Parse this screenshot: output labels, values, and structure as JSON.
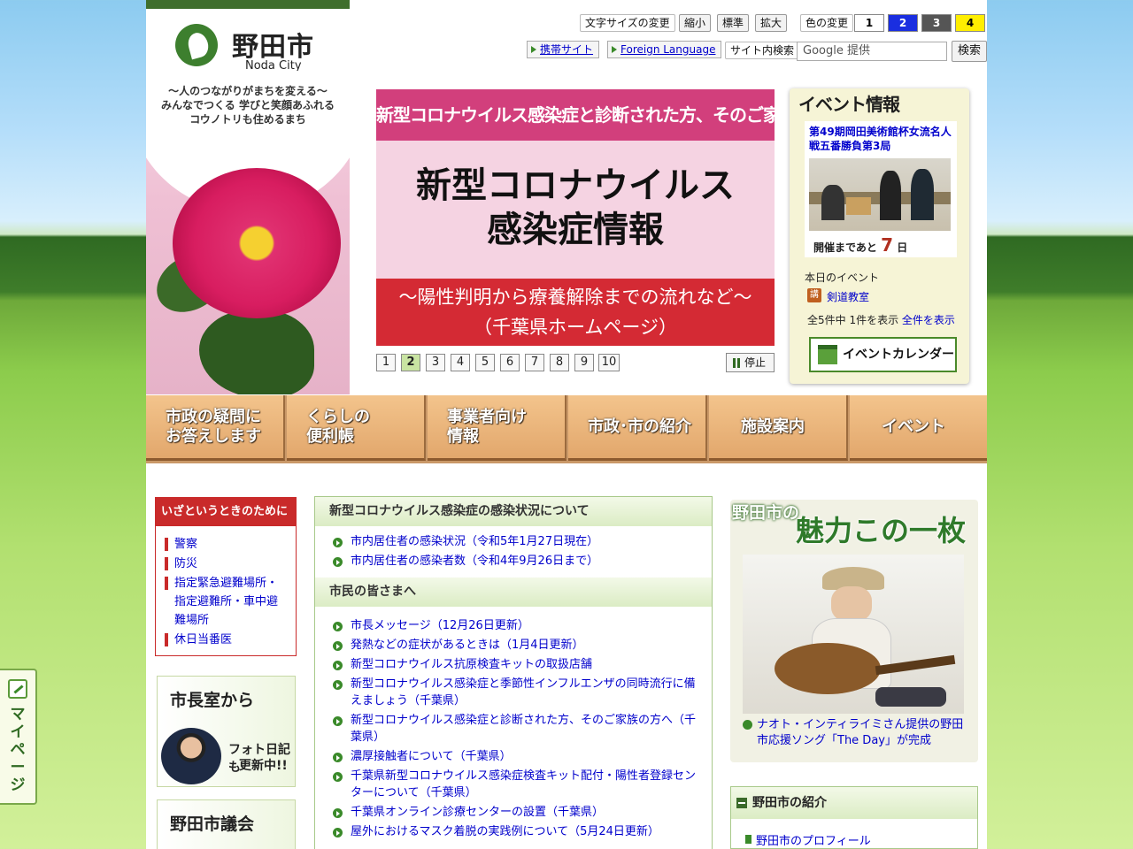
{
  "header": {
    "logo_ja": "野田市",
    "logo_en": "Noda City",
    "tagline": [
      "～人のつながりがまちを変える～",
      "みんなでつくる 学びと笑顔あふれる",
      "コウノトリも住めるまち"
    ],
    "font_size_label": "文字サイズの変更",
    "font_small": "縮小",
    "font_normal": "標準",
    "font_large": "拡大",
    "color_label": "色の変更",
    "colors": [
      "1",
      "2",
      "3",
      "4"
    ],
    "mobile_link": "携帯サイト",
    "foreign_link": "Foreign Language",
    "search_label": "サイト内検索",
    "search_placeholder": "Google 提供",
    "search_button": "検索"
  },
  "banner": {
    "top": "新型コロナウイルス感染症と診断された方、そのご家族の方へ",
    "title_line1": "新型コロナウイルス",
    "title_line2": "感染症情報",
    "sub_line1": "～陽性判明から療養解除までの流れなど～",
    "sub_line2": "（千葉県ホームページ）",
    "pages": [
      "1",
      "2",
      "3",
      "4",
      "5",
      "6",
      "7",
      "8",
      "9",
      "10"
    ],
    "active_page": 2,
    "stop_label": "停止"
  },
  "event": {
    "heading": "イベント情報",
    "featured_title": "第49期岡田美術館杯女流名人戦五番勝負第3局",
    "countdown_prefix": "開催まであと",
    "countdown_days": "7",
    "countdown_suffix": "日",
    "today_label": "本日のイベント",
    "today_icon": "講",
    "today_item": "剣道教室",
    "count_text": "全5件中 1件を表示",
    "show_all": "全件を表示",
    "calendar_button": "イベントカレンダー"
  },
  "nav": [
    [
      "市政の疑問に",
      "お答えします"
    ],
    [
      "くらしの",
      "便利帳"
    ],
    [
      "事業者向け",
      "情報"
    ],
    [
      "市政･市の紹介"
    ],
    [
      "施設案内"
    ],
    [
      "イベント"
    ]
  ],
  "emergency": {
    "heading": "いざというときのために",
    "items": [
      "警察",
      "防災",
      "指定緊急避難場所・指定避難所・車中避難場所",
      "休日当番医"
    ]
  },
  "mayor": {
    "title": "市長室から",
    "sub1": "フォト日記も",
    "sub2": "更新中!!"
  },
  "council": {
    "title": "野田市議会"
  },
  "center": {
    "sec1": "新型コロナウイルス感染症の感染状況について",
    "sec1_items": [
      "市内居住者の感染状況（令和5年1月27日現在）",
      "市内居住者の感染者数（令和4年9月26日まで）"
    ],
    "sec2": "市民の皆さまへ",
    "sec2_items": [
      "市長メッセージ（12月26日更新）",
      "発熱などの症状があるときは（1月4日更新）",
      "新型コロナウイルス抗原検査キットの取扱店舗",
      "新型コロナウイルス感染症と季節性インフルエンザの同時流行に備えましょう（千葉県）",
      "新型コロナウイルス感染症と診断された方、そのご家族の方へ（千葉県）",
      "濃厚接触者について（千葉県）",
      "千葉県新型コロナウイルス感染症検査キット配付・陽性者登録センターについて（千葉県）",
      "千葉県オンライン診療センターの設置（千葉県）",
      "屋外におけるマスク着脱の実践例について（5月24日更新）"
    ]
  },
  "charm": {
    "heading_small": "野田市の",
    "heading_large": "魅力この一枚",
    "caption": "ナオト・インティライミさん提供の野田市応援ソング「The Day」が完成"
  },
  "intro": {
    "heading": "野田市の紹介",
    "link": "野田市のプロフィール"
  },
  "mypage": {
    "label": "マイページ"
  }
}
